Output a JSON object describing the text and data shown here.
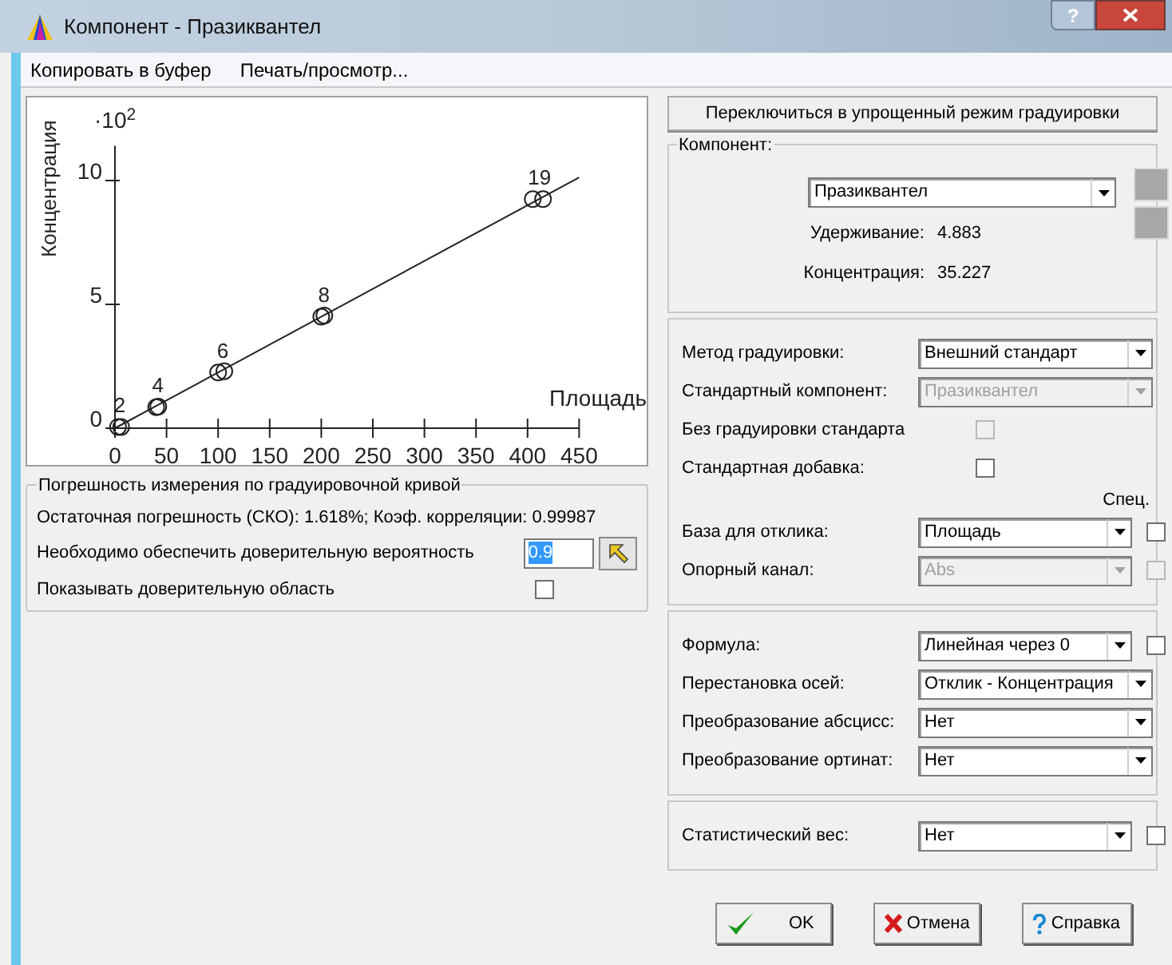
{
  "window": {
    "title": "Компонент - Празиквантел",
    "help": "?"
  },
  "menu": [
    "Копировать в буфер",
    "Печать/просмотр..."
  ],
  "chart_multiplier": "·10$^{2}$",
  "chart_data": {
    "type": "scatter",
    "xlabel": "Площадь",
    "ylabel": "Концентрация",
    "x": [
      3,
      6,
      40,
      42,
      100,
      106,
      200,
      203,
      405,
      415
    ],
    "values": [
      0.05,
      0.05,
      0.85,
      0.87,
      2.25,
      2.3,
      4.5,
      4.55,
      9.25,
      9.25
    ],
    "xlim": [
      0,
      450
    ],
    "ylim": [
      0,
      11.4
    ],
    "xticks": [
      0,
      50,
      100,
      150,
      200,
      250,
      300,
      350,
      400,
      450
    ],
    "yticks": [
      0,
      5,
      10
    ],
    "annotations": [
      {
        "text": "2",
        "x": 3,
        "y": 0.05
      },
      {
        "text": "4",
        "x": 40,
        "y": 0.86
      },
      {
        "text": "6",
        "x": 103,
        "y": 2.27
      },
      {
        "text": "8",
        "x": 201,
        "y": 4.52
      },
      {
        "text": "19",
        "x": 410,
        "y": 9.25
      }
    ]
  },
  "error_group": {
    "title": "Погрешность измерения по градуировочной кривой",
    "residual": "Остаточная погрешность (СКО): 1.618%;  Коэф. корреляции: 0.99987",
    "confidence_label": "Необходимо обеспечить доверительную вероятность",
    "confidence_value": "0.9",
    "show_area_label": "Показывать доверительную область",
    "show_area_checked": false
  },
  "switch_button": "Переключиться в упрощенный режим градуировки",
  "component_group": {
    "title": "Компонент:",
    "value": "Празиквантел",
    "retention_label": "Удерживание:",
    "retention": "4.883",
    "concentration_label": "Концентрация:",
    "concentration": "35.227"
  },
  "spec_header": "Спец.",
  "sections": [
    [
      {
        "kind": "select",
        "label": "Метод градуировки:",
        "value": "Внешний стандарт",
        "disabled": false
      },
      {
        "kind": "select",
        "label": "Стандартный компонент:",
        "value": "Празиквантел",
        "disabled": true
      },
      {
        "kind": "checkbox",
        "label": "Без градуировки стандарта",
        "checked": false,
        "disabled": true
      },
      {
        "kind": "checkbox",
        "label": "Стандартная добавка:",
        "checked": false,
        "disabled": false
      },
      {
        "kind": "spec_header"
      },
      {
        "kind": "select",
        "label": "База для отклика:",
        "value": "Площадь",
        "disabled": false,
        "spec": {
          "checked": false,
          "disabled": false
        }
      },
      {
        "kind": "select",
        "label": "Опорный канал:",
        "value": "Abs",
        "disabled": true,
        "spec": {
          "checked": false,
          "disabled": true
        }
      }
    ],
    [
      {
        "kind": "select",
        "label": "Формула:",
        "value": "Линейная через 0",
        "disabled": false,
        "spec": {
          "checked": false,
          "disabled": false
        }
      },
      {
        "kind": "select",
        "label": "Перестановка осей:",
        "value": "Отклик - Концентрация",
        "disabled": false
      },
      {
        "kind": "select",
        "label": "Преобразование абсцисс:",
        "value": "Нет",
        "disabled": false
      },
      {
        "kind": "select",
        "label": "Преобразование ортинат:",
        "value": "Нет",
        "disabled": false
      }
    ],
    [
      {
        "kind": "select",
        "label": "Статистический вес:",
        "value": "Нет",
        "disabled": false,
        "spec": {
          "checked": false,
          "disabled": false
        }
      }
    ]
  ],
  "buttons": [
    {
      "kind": "ok",
      "label": "OK"
    },
    {
      "kind": "cancel",
      "label": "Отмена"
    },
    {
      "kind": "help",
      "label": "Справка"
    }
  ]
}
